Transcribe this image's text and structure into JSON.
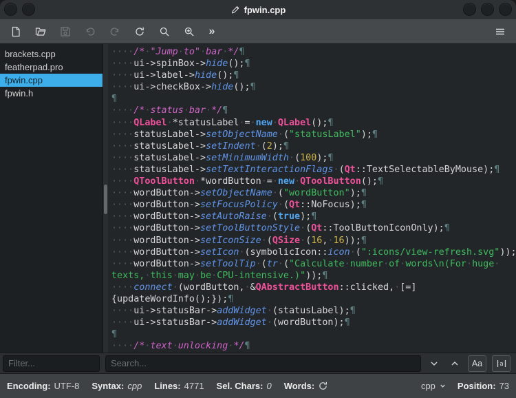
{
  "window": {
    "title": "fpwin.cpp"
  },
  "toolbar": {
    "buttons": [
      "new-file",
      "open-folder",
      "save",
      "undo",
      "redo",
      "reload",
      "search",
      "find-replace",
      "overflow",
      "menu"
    ],
    "disabled": [
      "save",
      "undo",
      "redo"
    ],
    "overflow_label": "»"
  },
  "sidebar": {
    "filter_placeholder": "Filter...",
    "files": [
      {
        "name": "brackets.cpp",
        "selected": false
      },
      {
        "name": "featherpad.pro",
        "selected": false
      },
      {
        "name": "fpwin.cpp",
        "selected": true
      },
      {
        "name": "fpwin.h",
        "selected": false
      }
    ]
  },
  "search": {
    "placeholder": "Search...",
    "case_button": "Aa"
  },
  "statusbar": {
    "encoding_label": "Encoding:",
    "encoding": "UTF-8",
    "syntax_label": "Syntax:",
    "syntax": "cpp",
    "lines_label": "Lines:",
    "lines": "4771",
    "sel_label": "Sel. Chars:",
    "sel": "0",
    "words_label": "Words:",
    "lang": "cpp",
    "position_label": "Position:",
    "position": "73"
  },
  "editor": {
    "lines": [
      {
        "ind": 4,
        "seg": [
          [
            "c",
            "/* \"Jump to\" bar */"
          ]
        ]
      },
      {
        "ind": 4,
        "seg": [
          [
            "p",
            "ui->spinBox->"
          ],
          [
            "f",
            "hide"
          ],
          [
            "p",
            "();"
          ]
        ]
      },
      {
        "ind": 4,
        "seg": [
          [
            "p",
            "ui->label->"
          ],
          [
            "f",
            "hide"
          ],
          [
            "p",
            "();"
          ]
        ]
      },
      {
        "ind": 4,
        "seg": [
          [
            "p",
            "ui->checkBox->"
          ],
          [
            "f",
            "hide"
          ],
          [
            "p",
            "();"
          ]
        ]
      },
      {
        "ind": 0,
        "seg": []
      },
      {
        "ind": 4,
        "seg": [
          [
            "c",
            "/* status bar */"
          ]
        ]
      },
      {
        "ind": 4,
        "seg": [
          [
            "q",
            "QLabel"
          ],
          [
            "p",
            " *statusLabel = "
          ],
          [
            "k",
            "new"
          ],
          [
            "p",
            " "
          ],
          [
            "q",
            "QLabel"
          ],
          [
            "p",
            "();"
          ]
        ]
      },
      {
        "ind": 4,
        "seg": [
          [
            "p",
            "statusLabel->"
          ],
          [
            "f",
            "setObjectName"
          ],
          [
            "p",
            " ("
          ],
          [
            "s",
            "\"statusLabel\""
          ],
          [
            "p",
            ");"
          ]
        ]
      },
      {
        "ind": 4,
        "seg": [
          [
            "p",
            "statusLabel->"
          ],
          [
            "f",
            "setIndent"
          ],
          [
            "p",
            " ("
          ],
          [
            "n",
            "2"
          ],
          [
            "p",
            ");"
          ]
        ]
      },
      {
        "ind": 4,
        "seg": [
          [
            "p",
            "statusLabel->"
          ],
          [
            "f",
            "setMinimumWidth"
          ],
          [
            "p",
            " ("
          ],
          [
            "n",
            "100"
          ],
          [
            "p",
            ");"
          ]
        ]
      },
      {
        "ind": 4,
        "seg": [
          [
            "p",
            "statusLabel->"
          ],
          [
            "f",
            "setTextInteractionFlags"
          ],
          [
            "p",
            " ("
          ],
          [
            "q",
            "Qt"
          ],
          [
            "p",
            "::TextSelectableByMouse);"
          ]
        ]
      },
      {
        "ind": 4,
        "seg": [
          [
            "q",
            "QToolButton"
          ],
          [
            "p",
            " *wordButton = "
          ],
          [
            "k",
            "new"
          ],
          [
            "p",
            " "
          ],
          [
            "q",
            "QToolButton"
          ],
          [
            "p",
            "();"
          ]
        ]
      },
      {
        "ind": 4,
        "seg": [
          [
            "p",
            "wordButton->"
          ],
          [
            "f",
            "setObjectName"
          ],
          [
            "p",
            " ("
          ],
          [
            "s",
            "\"wordButton\""
          ],
          [
            "p",
            ");"
          ]
        ]
      },
      {
        "ind": 4,
        "seg": [
          [
            "p",
            "wordButton->"
          ],
          [
            "f",
            "setFocusPolicy"
          ],
          [
            "p",
            " ("
          ],
          [
            "q",
            "Qt"
          ],
          [
            "p",
            "::NoFocus);"
          ]
        ]
      },
      {
        "ind": 4,
        "seg": [
          [
            "p",
            "wordButton->"
          ],
          [
            "f",
            "setAutoRaise"
          ],
          [
            "p",
            " ("
          ],
          [
            "k",
            "true"
          ],
          [
            "p",
            ");"
          ]
        ]
      },
      {
        "ind": 4,
        "seg": [
          [
            "p",
            "wordButton->"
          ],
          [
            "f",
            "setToolButtonStyle"
          ],
          [
            "p",
            " ("
          ],
          [
            "q",
            "Qt"
          ],
          [
            "p",
            "::ToolButtonIconOnly);"
          ]
        ]
      },
      {
        "ind": 4,
        "seg": [
          [
            "p",
            "wordButton->"
          ],
          [
            "f",
            "setIconSize"
          ],
          [
            "p",
            " ("
          ],
          [
            "q",
            "QSize"
          ],
          [
            "p",
            " ("
          ],
          [
            "n",
            "16"
          ],
          [
            "p",
            ", "
          ],
          [
            "n",
            "16"
          ],
          [
            "p",
            "));"
          ]
        ]
      },
      {
        "ind": 4,
        "seg": [
          [
            "p",
            "wordButton->"
          ],
          [
            "f",
            "setIcon"
          ],
          [
            "p",
            " (symbolicIcon::"
          ],
          [
            "f",
            "icon"
          ],
          [
            "p",
            " ("
          ],
          [
            "s",
            "\":icons/view-refresh.svg\""
          ],
          [
            "p",
            "));"
          ]
        ]
      },
      {
        "ind": 4,
        "nl": false,
        "seg": [
          [
            "p",
            "wordButton->"
          ],
          [
            "f",
            "setToolTip"
          ],
          [
            "p",
            " ("
          ],
          [
            "f",
            "tr"
          ],
          [
            "p",
            " ("
          ],
          [
            "s",
            "\"Calculate number of words\\n(For huge "
          ]
        ]
      },
      {
        "ind": 0,
        "seg": [
          [
            "s",
            "texts, this may be CPU-intensive.)\""
          ],
          [
            "p",
            "));"
          ]
        ]
      },
      {
        "ind": 4,
        "nl": false,
        "seg": [
          [
            "f",
            "connect"
          ],
          [
            "p",
            " (wordButton, &"
          ],
          [
            "q",
            "QAbstractButton"
          ],
          [
            "p",
            "::clicked, [=]"
          ]
        ]
      },
      {
        "ind": 0,
        "seg": [
          [
            "p",
            "{updateWordInfo();});"
          ]
        ]
      },
      {
        "ind": 4,
        "seg": [
          [
            "p",
            "ui->statusBar->"
          ],
          [
            "f",
            "addWidget"
          ],
          [
            "p",
            " (statusLabel);"
          ]
        ]
      },
      {
        "ind": 4,
        "seg": [
          [
            "p",
            "ui->statusBar->"
          ],
          [
            "f",
            "addWidget"
          ],
          [
            "p",
            " (wordButton);"
          ]
        ]
      },
      {
        "ind": 0,
        "seg": []
      },
      {
        "ind": 4,
        "seg": [
          [
            "c",
            "/* text unlocking */"
          ]
        ]
      }
    ]
  }
}
